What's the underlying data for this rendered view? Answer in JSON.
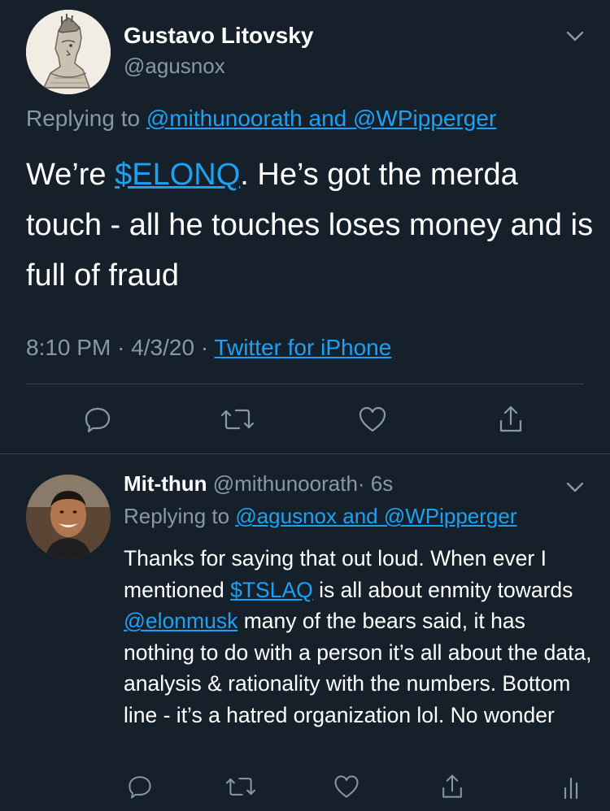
{
  "main_tweet": {
    "author_name": "Gustavo Litovsky",
    "author_handle": "@agusnox",
    "replying_prefix": "Replying to",
    "replying_to": "@mithunoorath and @WPipperger",
    "text_before": "We’re ",
    "cashtag": "$ELONQ",
    "text_after": ". He’s got the merda touch - all he touches loses money and is full of fraud",
    "time": "8:10 PM",
    "date": "4/3/20",
    "separator": "·",
    "source": "Twitter for iPhone",
    "icons": [
      "reply-icon",
      "retweet-icon",
      "like-icon",
      "share-icon",
      "chevron-down-icon"
    ]
  },
  "reply_tweet": {
    "author_name": "Mit-thun",
    "author_handle": "@mithunoorath",
    "time_ago": "· 6s",
    "replying_prefix": "Replying to",
    "replying_to": "@agusnox and @WPipperger",
    "t1": "Thanks for saying that out loud. When ever I mentioned ",
    "cashtag": "$TSLAQ",
    "t2": " is all about enmity towards ",
    "mention": "@elonmusk",
    "t3": " many of the bears said, it has nothing to do with a person it’s all about the data, analysis & rationality with the numbers. Bottom line - it’s a hatred organization lol. No wonder",
    "icons": [
      "reply-icon",
      "retweet-icon",
      "like-icon",
      "share-icon",
      "analytics-icon",
      "chevron-down-icon"
    ]
  },
  "colors": {
    "background": "#15202b",
    "link": "#1da1f2",
    "muted": "#8899a6",
    "divider": "#38444d"
  }
}
